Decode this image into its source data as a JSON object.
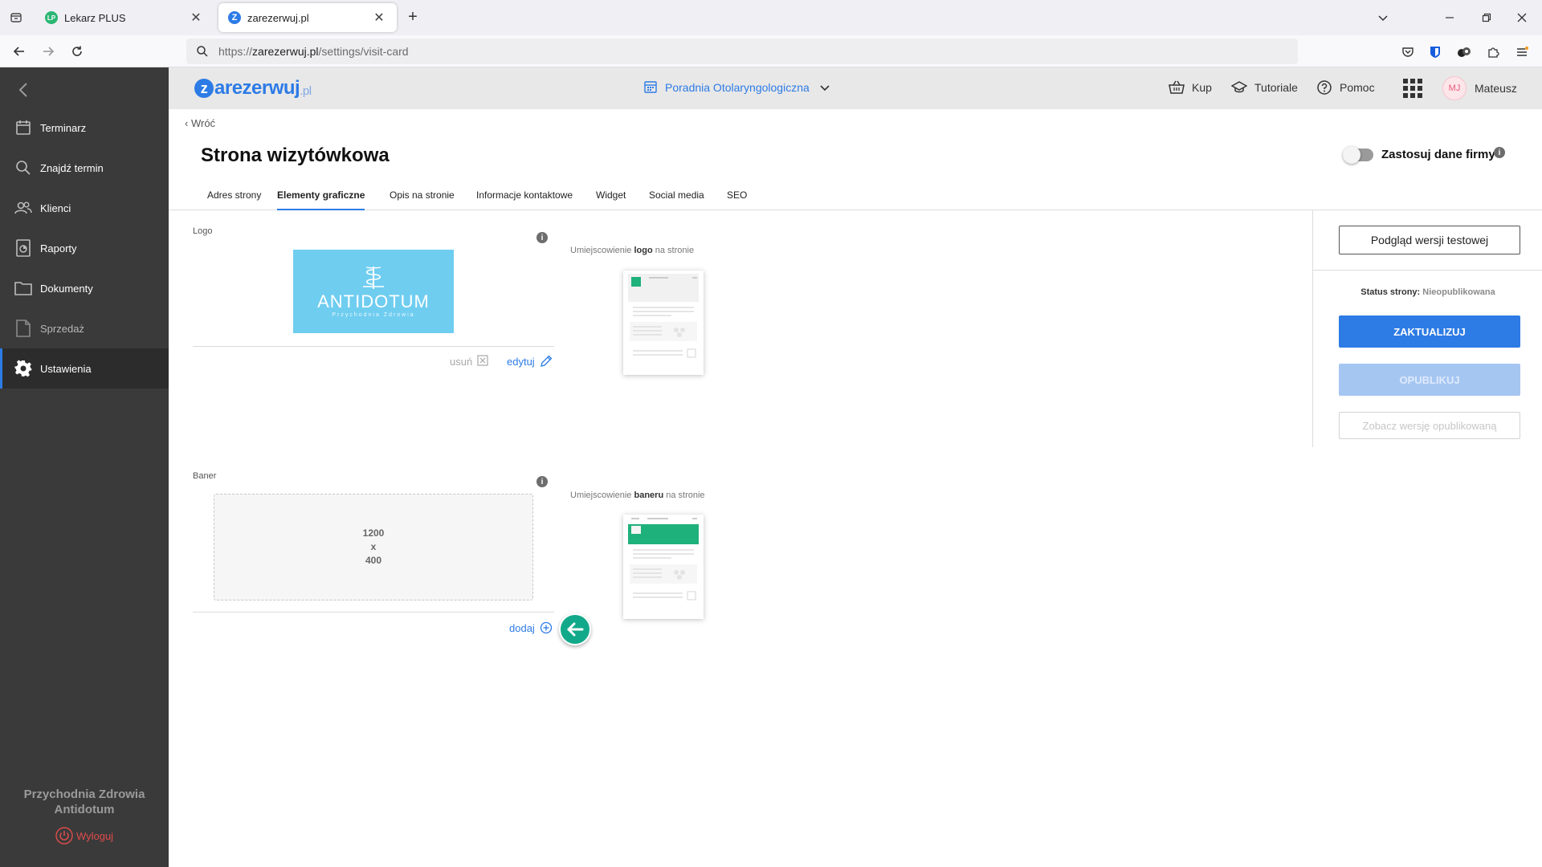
{
  "browser": {
    "tabs": [
      {
        "title": "Lekarz PLUS",
        "favicon": "LP"
      },
      {
        "title": "zarezerwuj.pl",
        "favicon": "Z"
      }
    ],
    "url_scheme": "https://",
    "url_host": "zarezerwuj.pl",
    "url_path": "/settings/visit-card"
  },
  "sidebar": {
    "items": [
      {
        "label": "Terminarz",
        "icon": "calendar-icon"
      },
      {
        "label": "Znajdź termin",
        "icon": "search-icon"
      },
      {
        "label": "Klienci",
        "icon": "users-icon"
      },
      {
        "label": "Raporty",
        "icon": "report-icon"
      },
      {
        "label": "Dokumenty",
        "icon": "folder-icon"
      },
      {
        "label": "Sprzedaż",
        "icon": "document-icon"
      },
      {
        "label": "Ustawienia",
        "icon": "gear-icon"
      }
    ],
    "company": "Przychodnia Zdrowia Antidotum",
    "logout": "Wyloguj"
  },
  "header": {
    "logo_main": "arezerwuj",
    "logo_letter": "z",
    "logo_tld": ".pl",
    "clinic": "Poradnia Otolaryngologiczna",
    "menu": {
      "buy": "Kup",
      "tutorials": "Tutoriale",
      "help": "Pomoc",
      "user_initials": "MJ",
      "user_name": "Mateusz"
    }
  },
  "page": {
    "back": "Wróć",
    "title": "Strona wizytówkowa",
    "toggle_label": "Zastosuj dane firmy",
    "info": "i",
    "tabs": [
      "Adres strony",
      "Elementy graficzne",
      "Opis na stronie",
      "Informacje kontaktowe",
      "Widget",
      "Social media",
      "SEO"
    ],
    "active_tab": 1
  },
  "logo_section": {
    "label": "Logo",
    "preview_word": "ANTIDOTUM",
    "preview_sub": "Przychodnia Zdrowia",
    "remove": "usuń",
    "edit": "edytuj",
    "placement_prefix": "Umiejscowienie ",
    "placement_bold": "logo",
    "placement_suffix": " na stronie"
  },
  "banner_section": {
    "label": "Baner",
    "size_w": "1200",
    "size_x": "x",
    "size_h": "400",
    "add": "dodaj",
    "placement_prefix": "Umiejscowienie ",
    "placement_bold": "baneru",
    "placement_suffix": " na stronie"
  },
  "right_panel": {
    "preview_btn": "Podgląd wersji testowej",
    "status_label": "Status strony:",
    "status_value": "Nieopublikowana",
    "update_btn": "ZAKTUALIZUJ",
    "publish_btn": "OPUBLIKUJ",
    "view_published_btn": "Zobacz wersję opublikowaną"
  },
  "colors": {
    "accent": "#2d7be5",
    "sidebar_bg": "#3a3a3a",
    "fab": "#12a98a",
    "thumb_accent": "#1fb17b"
  }
}
